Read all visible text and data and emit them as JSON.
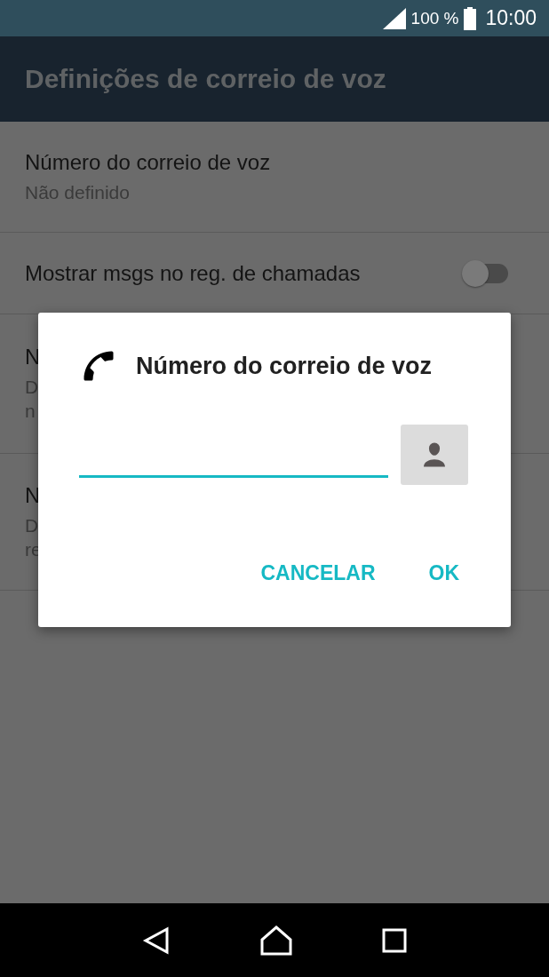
{
  "status_bar": {
    "battery": "100 %",
    "time": "10:00"
  },
  "app_bar": {
    "title": "Definições de correio de voz"
  },
  "settings": [
    {
      "kind": "text",
      "title": "Número do correio de voz",
      "summary": [
        "Não definido"
      ]
    },
    {
      "kind": "switch",
      "title": "Mostrar msgs no reg. de chamadas",
      "on": false
    },
    {
      "kind": "text",
      "title": "N",
      "summary": [
        "D",
        "n"
      ]
    },
    {
      "kind": "text",
      "title": "N",
      "summary": [
        "D",
        "re"
      ]
    }
  ],
  "dialog": {
    "title": "Número do correio de voz",
    "buttons": [
      "CANCELAR",
      "OK"
    ]
  }
}
